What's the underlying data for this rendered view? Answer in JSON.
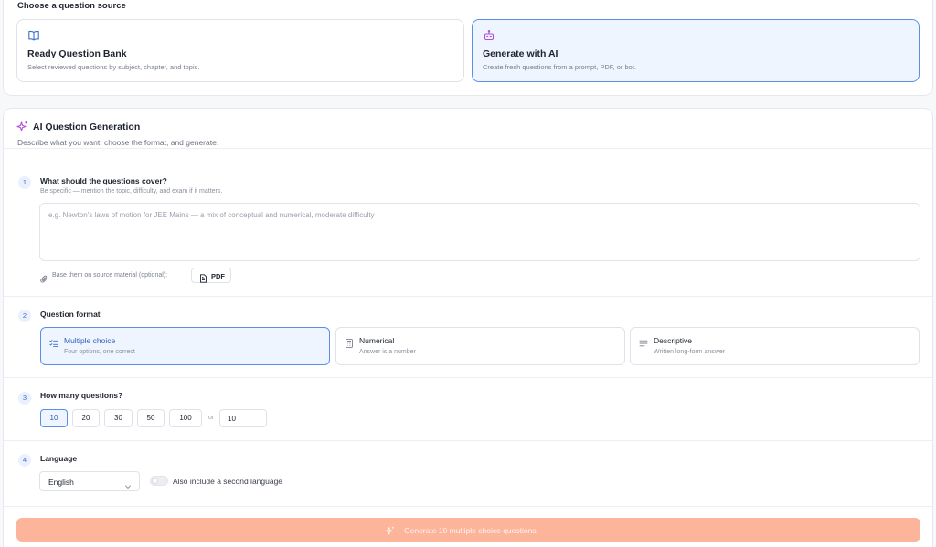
{
  "source_section": {
    "heading": "Choose a question source",
    "options": [
      {
        "title": "Ready Question Bank",
        "subtitle": "Select reviewed questions by subject, chapter, and topic.",
        "icon": "book-icon",
        "selected": false
      },
      {
        "title": "Generate with AI",
        "subtitle": "Create fresh questions from a prompt, PDF, or bot.",
        "icon": "robot-icon",
        "selected": true
      }
    ]
  },
  "generation": {
    "title": "AI Question Generation",
    "subtitle": "Describe what you want, choose the format, and generate.",
    "icon": "sparkle-icon"
  },
  "steps": {
    "topic": {
      "number": "1",
      "title": "What should the questions cover?",
      "hint": "Be specific — mention the topic, difficulty, and exam if it matters.",
      "placeholder": "e.g. Newton's laws of motion for JEE Mains — a mix of conceptual and numerical, moderate difficulty",
      "value": "",
      "source_label": "Base them on source material (optional):",
      "pdf_label": "PDF"
    },
    "format": {
      "number": "2",
      "title": "Question format",
      "options": [
        {
          "title": "Multiple choice",
          "subtitle": "Four options, one correct",
          "icon": "checklist-icon",
          "selected": true
        },
        {
          "title": "Numerical",
          "subtitle": "Answer is a number",
          "icon": "calculator-icon",
          "selected": false
        },
        {
          "title": "Descriptive",
          "subtitle": "Written long-form answer",
          "icon": "text-lines-icon",
          "selected": false
        }
      ]
    },
    "count": {
      "number": "3",
      "title": "How many questions?",
      "options": [
        "10",
        "20",
        "30",
        "50",
        "100"
      ],
      "selected": "10",
      "or_label": "or",
      "custom_value": "10"
    },
    "language": {
      "number": "4",
      "title": "Language",
      "selected": "English",
      "toggle_label": "Also include a second language",
      "toggle_on": false
    }
  },
  "generate_button": {
    "label": "Generate 10 multiple choice questions",
    "color": "#fcb59b"
  },
  "colors": {
    "accent": "#5b8fe6",
    "selected_bg": "#eef5ff",
    "ai_icon": "#b14fd8"
  }
}
